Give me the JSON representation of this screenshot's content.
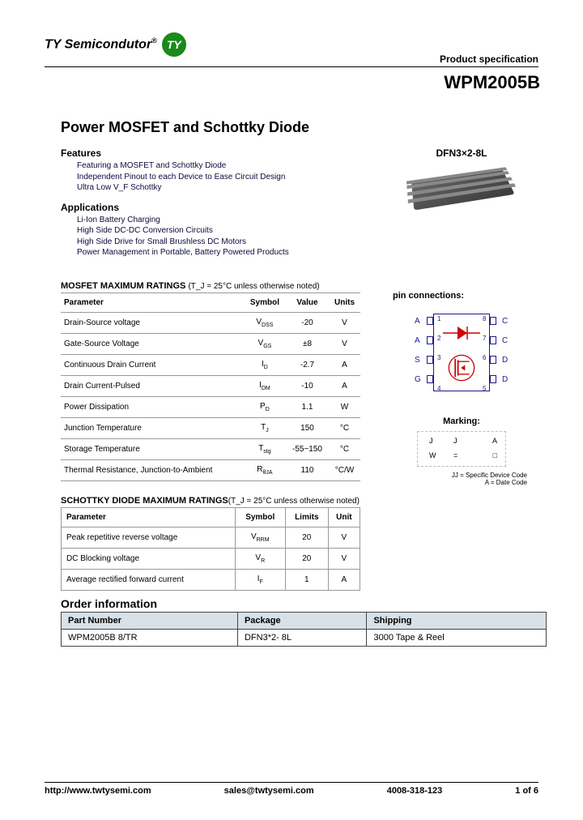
{
  "header": {
    "company": "TY Semicondutor",
    "spec_label": "Product specification",
    "part_number": "WPM2005B"
  },
  "title": "Power MOSFET and Schottky Diode",
  "features": {
    "heading": "Features",
    "items": [
      "Featuring a MOSFET and Schottky Diode",
      "Independent Pinout to each Device to Ease Circuit Design",
      "Ultra Low V_F Schottky"
    ]
  },
  "applications": {
    "heading": "Applications",
    "items": [
      "Li-Ion Battery Charging",
      "High Side DC-DC Conversion Circuits",
      "High Side Drive for Small Brushless DC Motors",
      "Power Management in Portable, Battery Powered Products"
    ]
  },
  "package_label": "DFN3×2-8L",
  "mosfet_table": {
    "title": "MOSFET MAXIMUM RATINGS",
    "note": "(T_J = 25°C  unless otherwise noted)",
    "headers": [
      "Parameter",
      "Symbol",
      "Value",
      "Units"
    ],
    "rows": [
      [
        "Drain-Source voltage",
        "V_DSS",
        "-20",
        "V"
      ],
      [
        "Gate-Source Voltage",
        "V_GS",
        "±8",
        "V"
      ],
      [
        "Continuous Drain Current",
        "I_D",
        "-2.7",
        "A"
      ],
      [
        "Drain Current-Pulsed",
        "I_DM",
        "-10",
        "A"
      ],
      [
        "Power Dissipation",
        "P_D",
        "1.1",
        "W"
      ],
      [
        "Junction Temperature",
        "T_J",
        "150",
        "°C"
      ],
      [
        "Storage Temperature",
        "T_stg",
        "-55~150",
        "°C"
      ],
      [
        "Thermal Resistance, Junction-to-Ambient",
        "R_θJA",
        "110",
        "°C/W"
      ]
    ]
  },
  "schottky_table": {
    "title": "SCHOTTKY DIODE MAXIMUM RATINGS",
    "note": "(T_J = 25°C  unless otherwise noted)",
    "headers": [
      "Parameter",
      "Symbol",
      "Limits",
      "Unit"
    ],
    "rows": [
      [
        "Peak repetitive reverse voltage",
        "V_RRM",
        "20",
        "V"
      ],
      [
        "DC Blocking voltage",
        "V_R",
        "20",
        "V"
      ],
      [
        "Average rectified forward current",
        "I_F",
        "1",
        "A"
      ]
    ]
  },
  "pin_connections": {
    "heading": "pin connections:",
    "left_labels": [
      "A",
      "A",
      "S",
      "G"
    ],
    "right_labels": [
      "C",
      "C",
      "D",
      "D"
    ],
    "left_nums": [
      "1",
      "2",
      "3",
      "4"
    ],
    "right_nums": [
      "8",
      "7",
      "6",
      "5"
    ]
  },
  "marking": {
    "heading": "Marking:",
    "legend": [
      "JJ = Specific Device Code",
      "A = Date Code"
    ]
  },
  "order": {
    "heading": "Order information",
    "headers": [
      "Part Number",
      "Package",
      "Shipping"
    ],
    "row": [
      "WPM2005B 8/TR",
      "DFN3*2- 8L",
      "3000 Tape & Reel"
    ]
  },
  "footer": {
    "url": "http://www.twtysemi.com",
    "email": "sales@twtysemi.com",
    "phone": "4008-318-123",
    "page": "1 of 6"
  }
}
